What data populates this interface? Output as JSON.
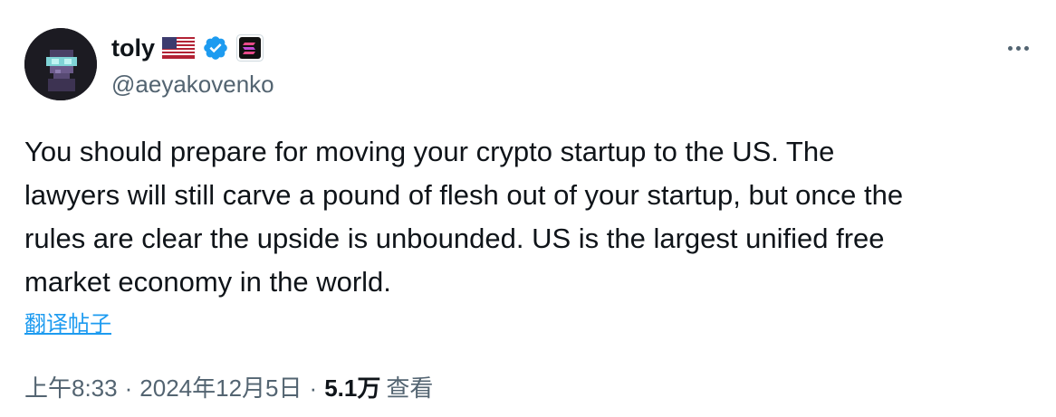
{
  "author": {
    "display_name": "toly",
    "handle": "@aeyakovenko",
    "badges": [
      "us-flag-icon",
      "verified-badge-icon",
      "solana-affiliate-icon"
    ]
  },
  "tweet": {
    "text_lines": [
      "You should prepare for moving your crypto startup to the US.  The",
      "lawyers will still carve a pound of flesh out of your startup, but once the",
      "rules are clear the upside is unbounded.  US is the largest unified free",
      "market economy in the world."
    ],
    "translate_label": "翻译帖子"
  },
  "meta": {
    "time": "上午8:33",
    "separator": "·",
    "date": "2024年12月5日",
    "views_count": "5.1万",
    "views_label": "查看"
  },
  "colors": {
    "text_primary": "#0f1419",
    "text_secondary": "#536471",
    "link": "#1d9bf0",
    "verified": "#1d9bf0"
  },
  "icons": {
    "more": "more-horizontal-icon"
  }
}
